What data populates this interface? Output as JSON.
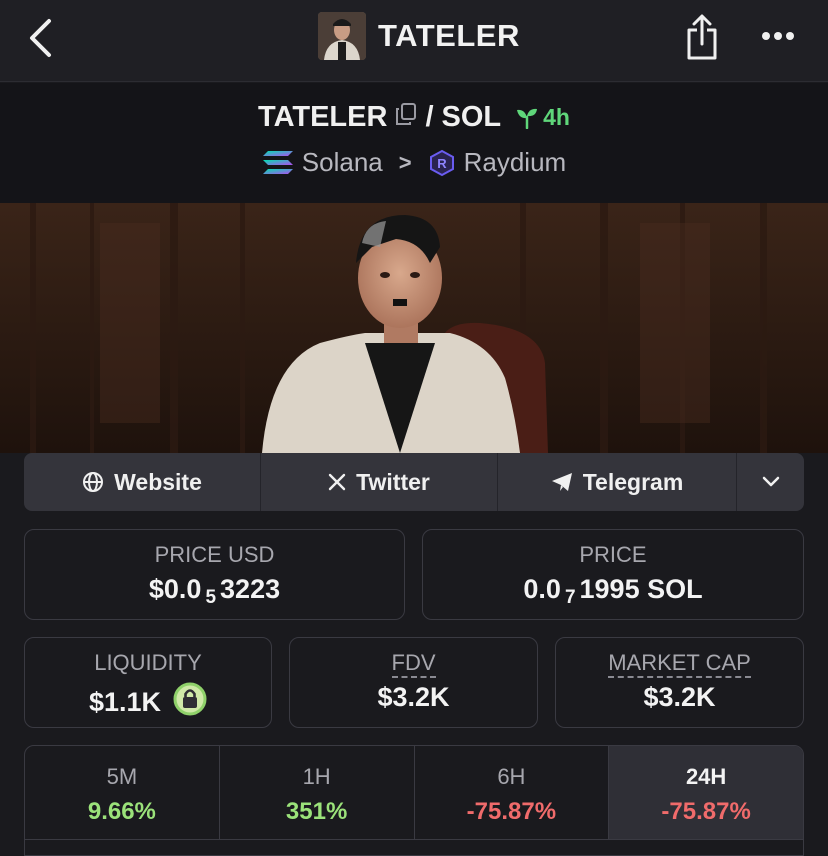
{
  "header": {
    "title": "TATELER",
    "icons": {
      "back": "chevron-left-icon",
      "share": "share-icon",
      "more": "more-horizontal-icon"
    }
  },
  "pair": {
    "base": "TATELER",
    "separator": "/",
    "quote": "SOL",
    "age": "4h",
    "chain": "Solana",
    "dex": "Raydium",
    "chain_sep": ">"
  },
  "links": [
    {
      "label": "Website",
      "icon": "globe-icon"
    },
    {
      "label": "Twitter",
      "icon": "x-logo-icon"
    },
    {
      "label": "Telegram",
      "icon": "telegram-icon"
    }
  ],
  "stats": {
    "price_usd": {
      "label": "PRICE USD",
      "prefix": "$0.0",
      "zeros": "5",
      "digits": "3223"
    },
    "price_sol": {
      "label": "PRICE",
      "prefix": "0.0",
      "zeros": "7",
      "digits": "1995 SOL"
    },
    "liquidity": {
      "label": "LIQUIDITY",
      "value": "$1.1K"
    },
    "fdv": {
      "label": "FDV",
      "value": "$3.2K"
    },
    "market_cap": {
      "label": "MARKET CAP",
      "value": "$3.2K"
    }
  },
  "timeframes": [
    {
      "label": "5M",
      "value": "9.66%",
      "trend": "up"
    },
    {
      "label": "1H",
      "value": "351%",
      "trend": "up"
    },
    {
      "label": "6H",
      "value": "-75.87%",
      "trend": "down"
    },
    {
      "label": "24H",
      "value": "-75.87%",
      "trend": "down",
      "active": true
    }
  ],
  "colors": {
    "positive": "#9be27a",
    "negative": "#f06b6b",
    "age": "#5fd67a"
  }
}
